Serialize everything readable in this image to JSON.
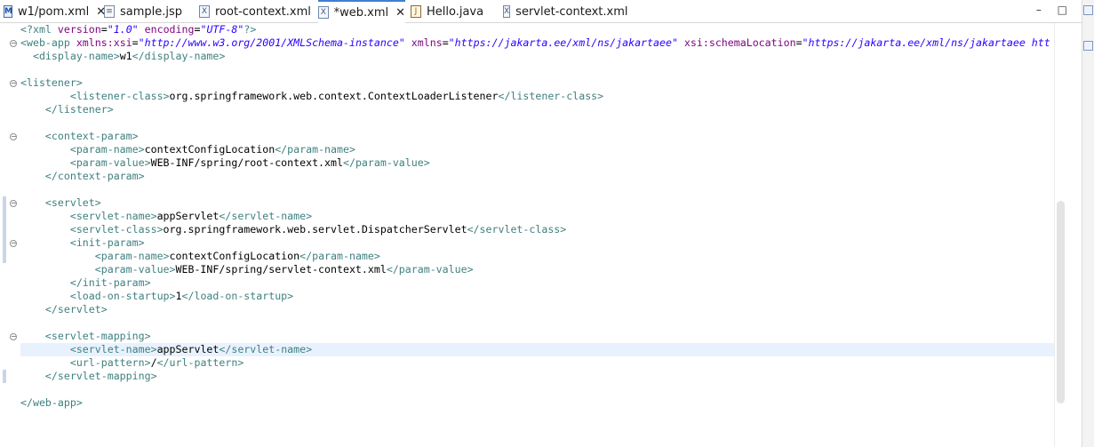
{
  "tabs": [
    {
      "label": "w1/pom.xml",
      "icon": "maven-file-icon",
      "closable": true,
      "active": false
    },
    {
      "label": "sample.jsp",
      "icon": "jsp-file-icon",
      "closable": false,
      "active": false
    },
    {
      "label": "root-context.xml",
      "icon": "xml-file-icon",
      "closable": false,
      "active": false
    },
    {
      "label": "*web.xml",
      "icon": "xml-file-icon",
      "closable": true,
      "active": true
    },
    {
      "label": "Hello.java",
      "icon": "java-file-icon",
      "closable": false,
      "active": false
    },
    {
      "label": "servlet-context.xml",
      "icon": "xml-file-icon",
      "closable": false,
      "active": false
    }
  ],
  "window_buttons": {
    "minimize": "–",
    "maximize": "□"
  },
  "editor": {
    "highlighted_line": 25,
    "lines": [
      {
        "parts": [
          [
            "pi",
            "<?xml "
          ],
          [
            "att",
            "version"
          ],
          [
            "txt",
            "="
          ],
          [
            "str",
            "\"1.0\""
          ],
          [
            "txt",
            " "
          ],
          [
            "att",
            "encoding"
          ],
          [
            "txt",
            "="
          ],
          [
            "str",
            "\"UTF-8\""
          ],
          [
            "pi",
            "?>"
          ]
        ]
      },
      {
        "parts": [
          [
            "tag",
            "<web-app "
          ],
          [
            "att",
            "xmlns:xsi"
          ],
          [
            "txt",
            "="
          ],
          [
            "str",
            "\"http://www.w3.org/2001/XMLSchema-instance\""
          ],
          [
            "txt",
            " "
          ],
          [
            "att",
            "xmlns"
          ],
          [
            "txt",
            "="
          ],
          [
            "str",
            "\"https://jakarta.ee/xml/ns/jakartaee\""
          ],
          [
            "txt",
            " "
          ],
          [
            "att",
            "xsi:schemaLocation"
          ],
          [
            "txt",
            "="
          ],
          [
            "str",
            "\"https://jakarta.ee/xml/ns/jakartaee htt"
          ]
        ]
      },
      {
        "parts": [
          [
            "txt",
            "  "
          ],
          [
            "tag",
            "<display-name>"
          ],
          [
            "txt",
            "w1"
          ],
          [
            "tag",
            "</display-name>"
          ]
        ]
      },
      {
        "parts": []
      },
      {
        "parts": [
          [
            "tag",
            "<listener>"
          ]
        ]
      },
      {
        "parts": [
          [
            "txt",
            "        "
          ],
          [
            "tag",
            "<listener-class>"
          ],
          [
            "txt",
            "org.springframework.web.context.ContextLoaderListener"
          ],
          [
            "tag",
            "</listener-class>"
          ]
        ]
      },
      {
        "parts": [
          [
            "txt",
            "    "
          ],
          [
            "tag",
            "</listener>"
          ]
        ]
      },
      {
        "parts": []
      },
      {
        "parts": [
          [
            "txt",
            "    "
          ],
          [
            "tag",
            "<context-param>"
          ]
        ]
      },
      {
        "parts": [
          [
            "txt",
            "        "
          ],
          [
            "tag",
            "<param-name>"
          ],
          [
            "txt",
            "contextConfigLocation"
          ],
          [
            "tag",
            "</param-name>"
          ]
        ]
      },
      {
        "parts": [
          [
            "txt",
            "        "
          ],
          [
            "tag",
            "<param-value>"
          ],
          [
            "txt",
            "WEB-INF/spring/root-context.xml"
          ],
          [
            "tag",
            "</param-value>"
          ]
        ]
      },
      {
        "parts": [
          [
            "txt",
            "    "
          ],
          [
            "tag",
            "</context-param>"
          ]
        ]
      },
      {
        "parts": []
      },
      {
        "parts": [
          [
            "txt",
            "    "
          ],
          [
            "tag",
            "<servlet>"
          ]
        ]
      },
      {
        "parts": [
          [
            "txt",
            "        "
          ],
          [
            "tag",
            "<servlet-name>"
          ],
          [
            "txt",
            "appServlet"
          ],
          [
            "tag",
            "</servlet-name>"
          ]
        ]
      },
      {
        "parts": [
          [
            "txt",
            "        "
          ],
          [
            "tag",
            "<servlet-class>"
          ],
          [
            "txt",
            "org.springframework.web.servlet.DispatcherServlet"
          ],
          [
            "tag",
            "</servlet-class>"
          ]
        ]
      },
      {
        "parts": [
          [
            "txt",
            "        "
          ],
          [
            "tag",
            "<init-param>"
          ]
        ]
      },
      {
        "parts": [
          [
            "txt",
            "            "
          ],
          [
            "tag",
            "<param-name>"
          ],
          [
            "txt",
            "contextConfigLocation"
          ],
          [
            "tag",
            "</param-name>"
          ]
        ]
      },
      {
        "parts": [
          [
            "txt",
            "            "
          ],
          [
            "tag",
            "<param-value>"
          ],
          [
            "txt",
            "WEB-INF/spring/servlet-context.xml"
          ],
          [
            "tag",
            "</param-value>"
          ]
        ]
      },
      {
        "parts": [
          [
            "txt",
            "        "
          ],
          [
            "tag",
            "</init-param>"
          ]
        ]
      },
      {
        "parts": [
          [
            "txt",
            "        "
          ],
          [
            "tag",
            "<load-on-startup>"
          ],
          [
            "txt",
            "1"
          ],
          [
            "tag",
            "</load-on-startup>"
          ]
        ]
      },
      {
        "parts": [
          [
            "txt",
            "    "
          ],
          [
            "tag",
            "</servlet>"
          ]
        ]
      },
      {
        "parts": []
      },
      {
        "parts": [
          [
            "txt",
            "    "
          ],
          [
            "tag",
            "<servlet-mapping>"
          ]
        ]
      },
      {
        "parts": [
          [
            "txt",
            "        "
          ],
          [
            "tag",
            "<servlet-name>"
          ],
          [
            "txt",
            "appServlet"
          ],
          [
            "tag",
            "</servlet-name>"
          ]
        ]
      },
      {
        "parts": [
          [
            "txt",
            "        "
          ],
          [
            "tag",
            "<url-pattern>"
          ],
          [
            "txt",
            "/"
          ],
          [
            "tag",
            "</url-pattern>"
          ]
        ]
      },
      {
        "parts": [
          [
            "txt",
            "    "
          ],
          [
            "tag",
            "</servlet-mapping>"
          ]
        ]
      },
      {
        "parts": []
      },
      {
        "parts": [
          [
            "tag",
            "</web-app>"
          ]
        ]
      }
    ],
    "fold_lines": [
      1,
      4,
      8,
      13,
      16,
      23
    ]
  },
  "colors": {
    "tag": "#3f7f7f",
    "attribute": "#7f007f",
    "string": "#2a00ff",
    "text": "#000000",
    "active_tab": "#3c7fd6",
    "highlight": "#e8f2fe"
  }
}
